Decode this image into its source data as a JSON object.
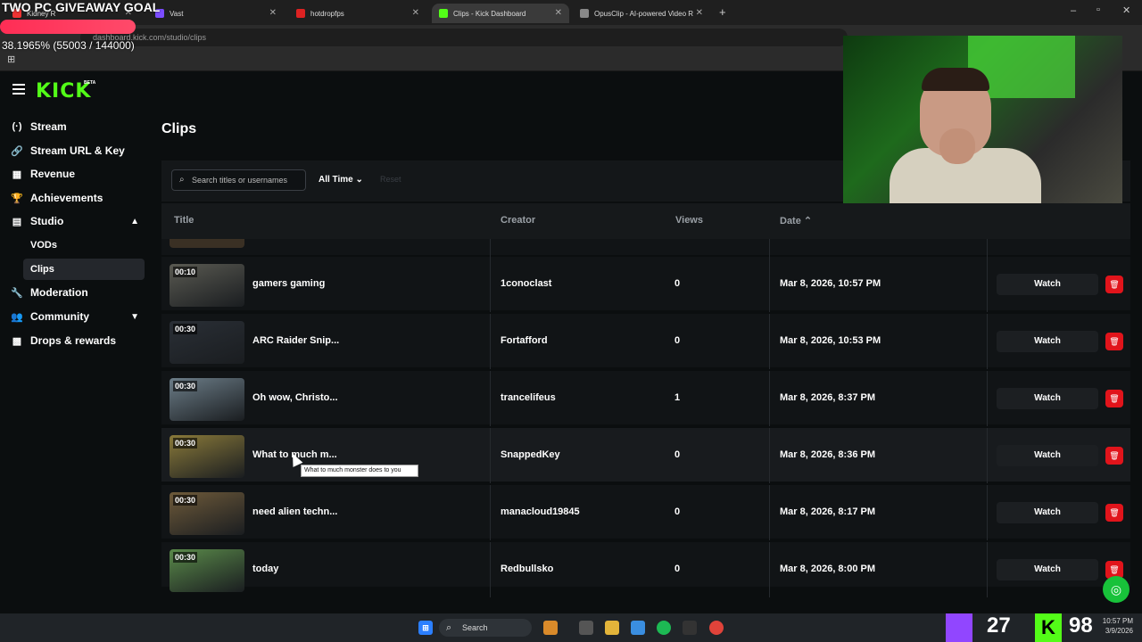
{
  "overlay": {
    "goal_text": "TWO PC GIVEAWAY GOAL",
    "goal_progress_pct": "38.1965% (55003 / 144000)",
    "goal_fraction": 0.382
  },
  "browser": {
    "tabs": [
      {
        "label": "Kidney R",
        "color": "#e33"
      },
      {
        "label": "Vast",
        "color": "#7b4cff"
      },
      {
        "label": "hotdropfps",
        "color": "#d22"
      },
      {
        "label": "Clips - Kick Dashboard",
        "color": "#53fc18"
      },
      {
        "label": "OpusClip - AI-powered Video R",
        "color": "#888"
      }
    ],
    "url": "dashboard.kick.com/studio/clips"
  },
  "sidebar": {
    "logo": "KICK",
    "beta": "BETA",
    "items": [
      {
        "label": "Stream",
        "icon": "(·)"
      },
      {
        "label": "Stream URL & Key",
        "icon": "🔗"
      },
      {
        "label": "Revenue",
        "icon": "▦"
      },
      {
        "label": "Achievements",
        "icon": "🏆"
      },
      {
        "label": "Studio",
        "icon": "▤"
      },
      {
        "label": "VODs"
      },
      {
        "label": "Clips"
      },
      {
        "label": "Moderation",
        "icon": "🔧"
      },
      {
        "label": "Community",
        "icon": "👥"
      },
      {
        "label": "Drops & rewards",
        "icon": "▩"
      }
    ]
  },
  "main": {
    "title": "Clips",
    "search_placeholder": "Search titles or usernames",
    "filter": "All Time",
    "reset": "Reset",
    "columns": {
      "title": "Title",
      "creator": "Creator",
      "views": "Views",
      "date": "Date"
    },
    "rows": [
      {
        "duration": "00:10",
        "title": "gamers gaming",
        "creator": "1conoclast",
        "views": "0",
        "date": "Mar 8, 2026, 10:57 PM",
        "thumb": "#5a5a52"
      },
      {
        "duration": "00:30",
        "title": "ARC Raider Snip...",
        "creator": "Fortafford",
        "views": "0",
        "date": "Mar 8, 2026, 10:53 PM",
        "thumb": "#2a2f36"
      },
      {
        "duration": "00:30",
        "title": "Oh wow, Christo...",
        "creator": "trancelifeus",
        "views": "1",
        "date": "Mar 8, 2026, 8:37 PM",
        "thumb": "#6c7d88"
      },
      {
        "duration": "00:30",
        "title": "What to much m...",
        "creator": "SnappedKey",
        "views": "0",
        "date": "Mar 8, 2026, 8:36 PM",
        "thumb": "#8a7a3a"
      },
      {
        "duration": "00:30",
        "title": "need alien techn...",
        "creator": "manacloud19845",
        "views": "0",
        "date": "Mar 8, 2026, 8:17 PM",
        "thumb": "#6e5a3a"
      },
      {
        "duration": "00:30",
        "title": "today",
        "creator": "Redbullsko",
        "views": "0",
        "date": "Mar 8, 2026, 8:00 PM",
        "thumb": "#5a8a4a"
      }
    ],
    "watch_label": "Watch",
    "tooltip": "What to much monster does to you"
  },
  "taskbar": {
    "search": "Search",
    "twitch_count": "27",
    "kick_count": "98",
    "time": "10:57 PM",
    "date": "3/9/2026"
  }
}
